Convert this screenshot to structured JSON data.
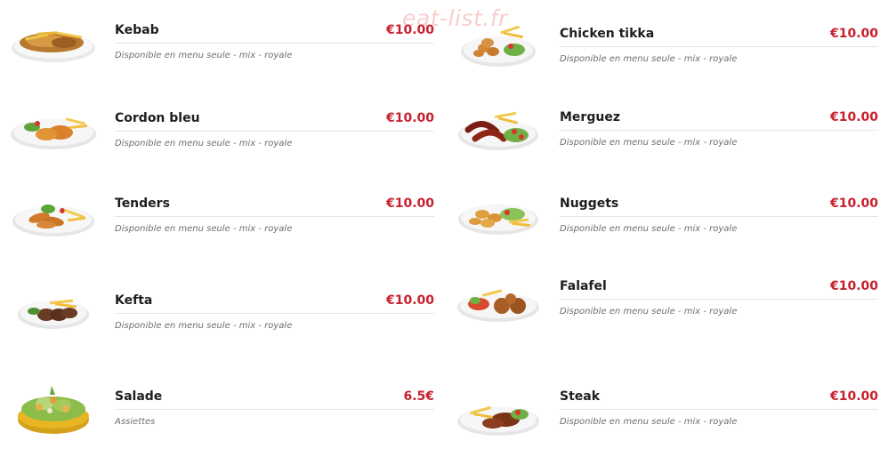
{
  "watermark": "eat-list.fr",
  "colors": {
    "price": "#c8202e",
    "title": "#1e1e1e",
    "description": "#6e6e6e",
    "rule": "#e6e6e6"
  },
  "left_column": [
    {
      "name": "Kebab",
      "price": "€10.00",
      "description": "Disponible en menu seule - mix - royale",
      "image": "kebab-plate"
    },
    {
      "name": "Cordon bleu",
      "price": "€10.00",
      "description": "Disponible en menu seule - mix - royale",
      "image": "cordon-bleu-plate"
    },
    {
      "name": "Tenders",
      "price": "€10.00",
      "description": "Disponible en menu seule - mix - royale",
      "image": "tenders-plate"
    },
    {
      "name": "Kefta",
      "price": "€10.00",
      "description": "Disponible en menu seule - mix - royale",
      "image": "kefta-plate"
    },
    {
      "name": "Salade",
      "price": "6.5€",
      "description": "Assiettes",
      "image": "salade-bowl"
    }
  ],
  "right_column": [
    {
      "name": "Chicken tikka",
      "price": "€10.00",
      "description": "Disponible en menu seule - mix - royale",
      "image": "chicken-tikka-plate"
    },
    {
      "name": "Merguez",
      "price": "€10.00",
      "description": "Disponible en menu seule - mix - royale",
      "image": "merguez-plate"
    },
    {
      "name": "Nuggets",
      "price": "€10.00",
      "description": "Disponible en menu seule - mix - royale",
      "image": "nuggets-plate"
    },
    {
      "name": "Falafel",
      "price": "€10.00",
      "description": "Disponible en menu seule - mix - royale",
      "image": "falafel-plate"
    },
    {
      "name": "Steak",
      "price": "€10.00",
      "description": "Disponible en menu seule - mix - royale",
      "image": "steak-plate"
    }
  ]
}
